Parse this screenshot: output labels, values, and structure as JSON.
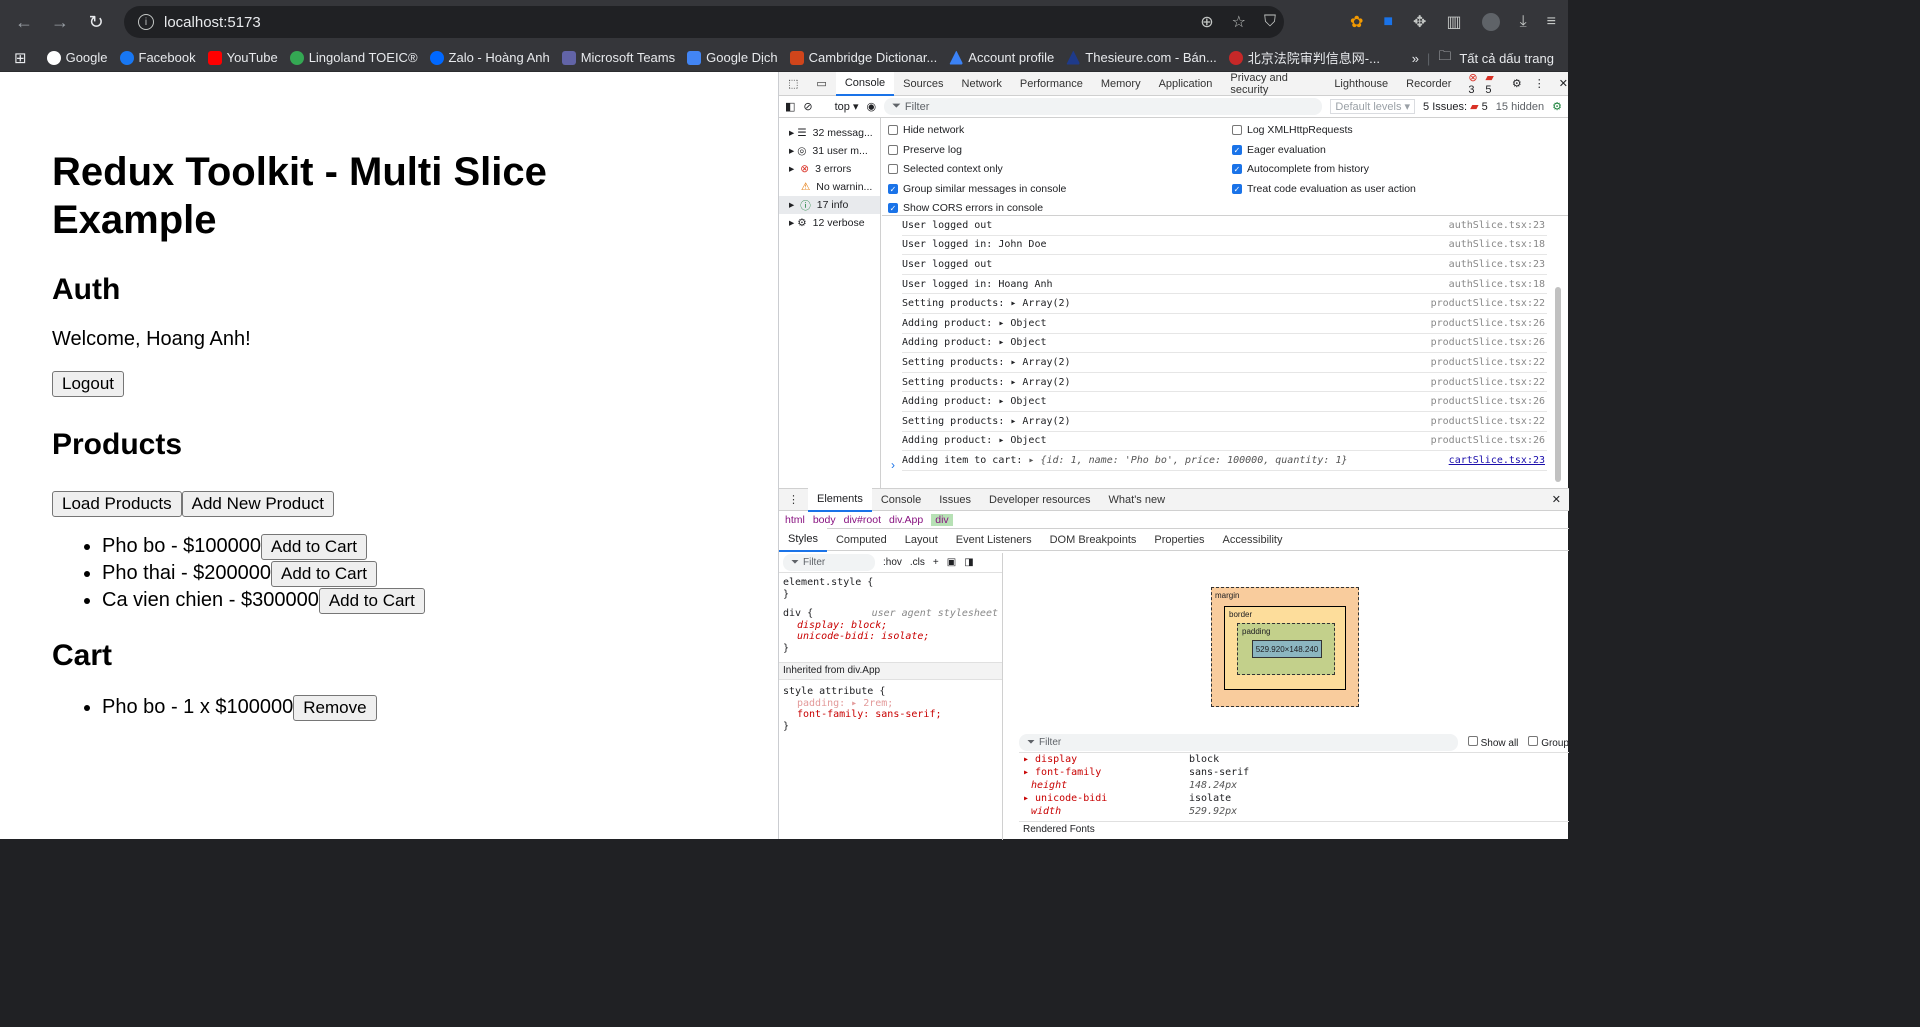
{
  "browser": {
    "url": "localhost:5173",
    "bookmarks": [
      "Google",
      "Facebook",
      "YouTube",
      "Lingoland TOEIC®",
      "Zalo - Hoàng Anh",
      "Microsoft Teams",
      "Google Dịch",
      "Cambridge Dictionar...",
      "Account profile",
      "Thesieure.com - Bán...",
      "北京法院审判信息网-..."
    ],
    "all_bookmarks": "Tất cả dấu trang"
  },
  "page": {
    "title": "Redux Toolkit - Multi Slice Example",
    "auth_heading": "Auth",
    "welcome": "Welcome, Hoang Anh!",
    "logout_label": "Logout",
    "products_heading": "Products",
    "load_label": "Load Products",
    "add_new_label": "Add New Product",
    "products": [
      {
        "text": "Pho bo - $100000",
        "btn": "Add to Cart"
      },
      {
        "text": "Pho thai - $200000",
        "btn": "Add to Cart"
      },
      {
        "text": "Ca vien chien - $300000",
        "btn": "Add to Cart"
      }
    ],
    "cart_heading": "Cart",
    "cart": [
      {
        "text": "Pho bo - 1 x $100000",
        "btn": "Remove"
      }
    ]
  },
  "devtools": {
    "tabs": [
      "Console",
      "Sources",
      "Network",
      "Performance",
      "Memory",
      "Application",
      "Privacy and security",
      "Lighthouse",
      "Recorder"
    ],
    "errors": "3",
    "warnings": "5",
    "context": "top",
    "filter_placeholder": "Filter",
    "levels": "Default levels",
    "issues": "5 Issues:",
    "issues_count": "5",
    "hidden": "15 hidden",
    "sidebar": [
      "32 messag...",
      "31 user m...",
      "3 errors",
      "No warnin...",
      "17 info",
      "12 verbose"
    ],
    "settings_left": [
      {
        "label": "Hide network",
        "checked": false
      },
      {
        "label": "Preserve log",
        "checked": false
      },
      {
        "label": "Selected context only",
        "checked": false
      },
      {
        "label": "Group similar messages in console",
        "checked": true
      },
      {
        "label": "Show CORS errors in console",
        "checked": true
      }
    ],
    "settings_right": [
      {
        "label": "Log XMLHttpRequests",
        "checked": false
      },
      {
        "label": "Eager evaluation",
        "checked": true
      },
      {
        "label": "Autocomplete from history",
        "checked": true
      },
      {
        "label": "Treat code evaluation as user action",
        "checked": true
      }
    ],
    "logs": [
      {
        "msg": "User logged out",
        "extra": "",
        "src": "authSlice.tsx:23"
      },
      {
        "msg": "User logged in: John Doe",
        "extra": "",
        "src": "authSlice.tsx:18"
      },
      {
        "msg": "User logged out",
        "extra": "",
        "src": "authSlice.tsx:23"
      },
      {
        "msg": "User logged in: Hoang Anh",
        "extra": "",
        "src": "authSlice.tsx:18"
      },
      {
        "msg": "Setting products: ",
        "extra": "▸ Array(2)",
        "src": "productSlice.tsx:22"
      },
      {
        "msg": "Adding product: ",
        "extra": "▸ Object",
        "src": "productSlice.tsx:26"
      },
      {
        "msg": "Adding product: ",
        "extra": "▸ Object",
        "src": "productSlice.tsx:26"
      },
      {
        "msg": "Setting products: ",
        "extra": "▸ Array(2)",
        "src": "productSlice.tsx:22"
      },
      {
        "msg": "Setting products: ",
        "extra": "▸ Array(2)",
        "src": "productSlice.tsx:22"
      },
      {
        "msg": "Adding product: ",
        "extra": "▸ Object",
        "src": "productSlice.tsx:26"
      },
      {
        "msg": "Setting products: ",
        "extra": "▸ Array(2)",
        "src": "productSlice.tsx:22"
      },
      {
        "msg": "Adding product: ",
        "extra": "▸ Object",
        "src": "productSlice.tsx:26"
      },
      {
        "msg": "Adding item to cart: ",
        "extra": "▸ {id: 1, name: 'Pho bo', price: 100000, quantity: 1}",
        "src": "cartSlice.tsx:23"
      }
    ],
    "drawer_tabs": [
      "Elements",
      "Console",
      "Issues",
      "Developer resources",
      "What's new"
    ],
    "crumbs": [
      "html",
      "body",
      "div#root",
      "div.App",
      "div"
    ],
    "style_tabs": [
      "Styles",
      "Computed",
      "Layout",
      "Event Listeners",
      "DOM Breakpoints",
      "Properties",
      "Accessibility"
    ],
    "styles_filter": "Filter",
    "hov": ":hov",
    "cls": ".cls",
    "styles": [
      "element.style {",
      "}",
      "div {",
      "display: block;",
      "unicode-bidi: isolate;",
      "}",
      "Inherited from div.App",
      "style attribute {",
      "padding: ▸ 2rem;",
      "font-family: sans-serif;",
      "}"
    ],
    "ua_label": "user agent stylesheet",
    "box": {
      "margin": "margin",
      "border": "border",
      "padding": "padding",
      "size": "529.920×148.240",
      "dash": "–"
    },
    "computed_filter": "Filter",
    "show_all": "Show all",
    "group": "Group",
    "computed": [
      {
        "prop": "display",
        "val": "block"
      },
      {
        "prop": "font-family",
        "val": "sans-serif"
      },
      {
        "prop": "height",
        "val": "148.24px"
      },
      {
        "prop": "unicode-bidi",
        "val": "isolate"
      },
      {
        "prop": "width",
        "val": "529.92px"
      }
    ],
    "rendered_fonts": "Rendered Fonts"
  }
}
